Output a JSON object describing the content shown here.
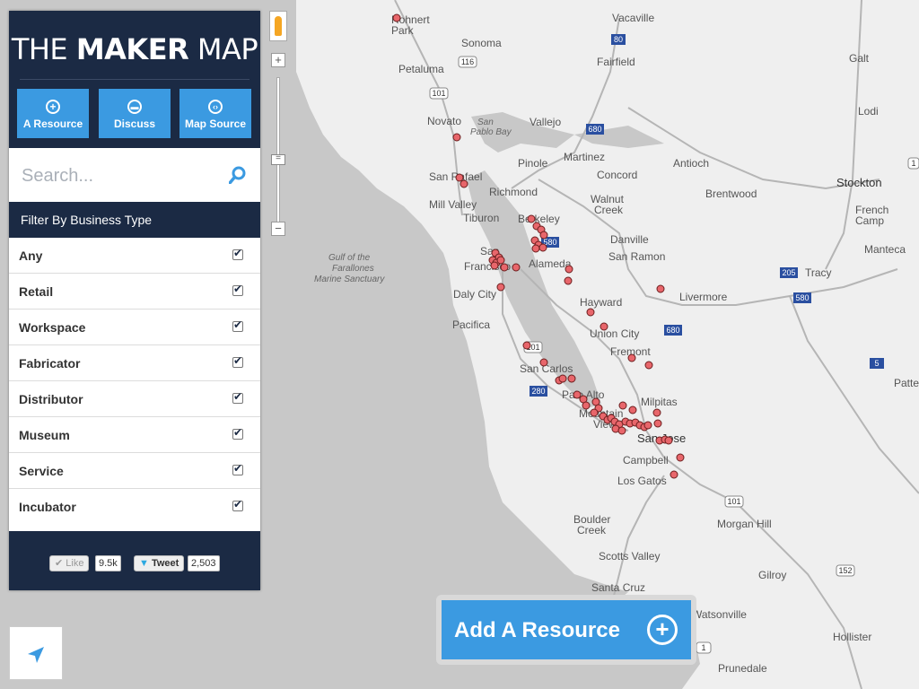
{
  "map": {
    "cities": [
      {
        "name": "Rohnert Park"
      },
      {
        "name": "Sonoma"
      },
      {
        "name": "Vacaville"
      },
      {
        "name": "Petaluma"
      },
      {
        "name": "Fairfield"
      },
      {
        "name": "Galt"
      },
      {
        "name": "Novato"
      },
      {
        "name": "Vallejo"
      },
      {
        "name": "Lodi"
      },
      {
        "name": "Pinole"
      },
      {
        "name": "Martinez"
      },
      {
        "name": "Concord"
      },
      {
        "name": "Antioch"
      },
      {
        "name": "San Rafael"
      },
      {
        "name": "Richmond"
      },
      {
        "name": "Walnut Creek"
      },
      {
        "name": "Brentwood"
      },
      {
        "name": "Stockton"
      },
      {
        "name": "Mill Valley"
      },
      {
        "name": "Berkeley"
      },
      {
        "name": "French Camp"
      },
      {
        "name": "Tiburon"
      },
      {
        "name": "Danville"
      },
      {
        "name": "San Francisco"
      },
      {
        "name": "Alameda"
      },
      {
        "name": "San Ramon"
      },
      {
        "name": "Manteca"
      },
      {
        "name": "Tracy"
      },
      {
        "name": "Daly City"
      },
      {
        "name": "Livermore"
      },
      {
        "name": "Hayward"
      },
      {
        "name": "Pacifica"
      },
      {
        "name": "Union City"
      },
      {
        "name": "Fremont"
      },
      {
        "name": "San Carlos"
      },
      {
        "name": "Palo Alto"
      },
      {
        "name": "Milpitas"
      },
      {
        "name": "Mountain View"
      },
      {
        "name": "San Jose"
      },
      {
        "name": "Campbell"
      },
      {
        "name": "Los Gatos"
      },
      {
        "name": "Morgan Hill"
      },
      {
        "name": "Boulder Creek"
      },
      {
        "name": "Scotts Valley"
      },
      {
        "name": "Gilroy"
      },
      {
        "name": "Santa Cruz"
      },
      {
        "name": "Watsonville"
      },
      {
        "name": "Hollister"
      },
      {
        "name": "Prunedale"
      },
      {
        "name": "Patterson"
      }
    ],
    "water_labels": [
      "San Pablo Bay",
      "Gulf of the Farallones Marine Sanctuary"
    ],
    "highway_shields": [
      "80",
      "116",
      "101",
      "680",
      "580",
      "205",
      "580",
      "680",
      "5",
      "280",
      "101",
      "101",
      "152",
      "1",
      "1"
    ],
    "marker_color": "#e8666b"
  },
  "zoom": {
    "in_label": "+",
    "out_label": "−",
    "thumb_label": "="
  },
  "sidebar": {
    "logo_light": "THE",
    "logo_bold": "MAKER",
    "logo_light2": "MAP",
    "buttons": [
      {
        "label": "A Resource",
        "icon": "plus-circle-icon"
      },
      {
        "label": "Discuss",
        "icon": "chat-icon"
      },
      {
        "label": "Map Source",
        "icon": "code-icon"
      }
    ],
    "search_placeholder": "Search...",
    "filter_title": "Filter By Business Type",
    "filters": [
      {
        "label": "Any",
        "checked": true
      },
      {
        "label": "Retail",
        "checked": true
      },
      {
        "label": "Workspace",
        "checked": true
      },
      {
        "label": "Fabricator",
        "checked": true
      },
      {
        "label": "Distributor",
        "checked": true
      },
      {
        "label": "Museum",
        "checked": true
      },
      {
        "label": "Service",
        "checked": true
      },
      {
        "label": "Incubator",
        "checked": true
      }
    ],
    "social": {
      "like_label": "Like",
      "like_count": "9.5k",
      "tweet_label": "Tweet",
      "tweet_count": "2,503"
    }
  },
  "add_resource": {
    "label": "Add A Resource"
  },
  "colors": {
    "navy": "#1b2a44",
    "blue": "#3b9ae1",
    "marker": "#e8666b"
  }
}
